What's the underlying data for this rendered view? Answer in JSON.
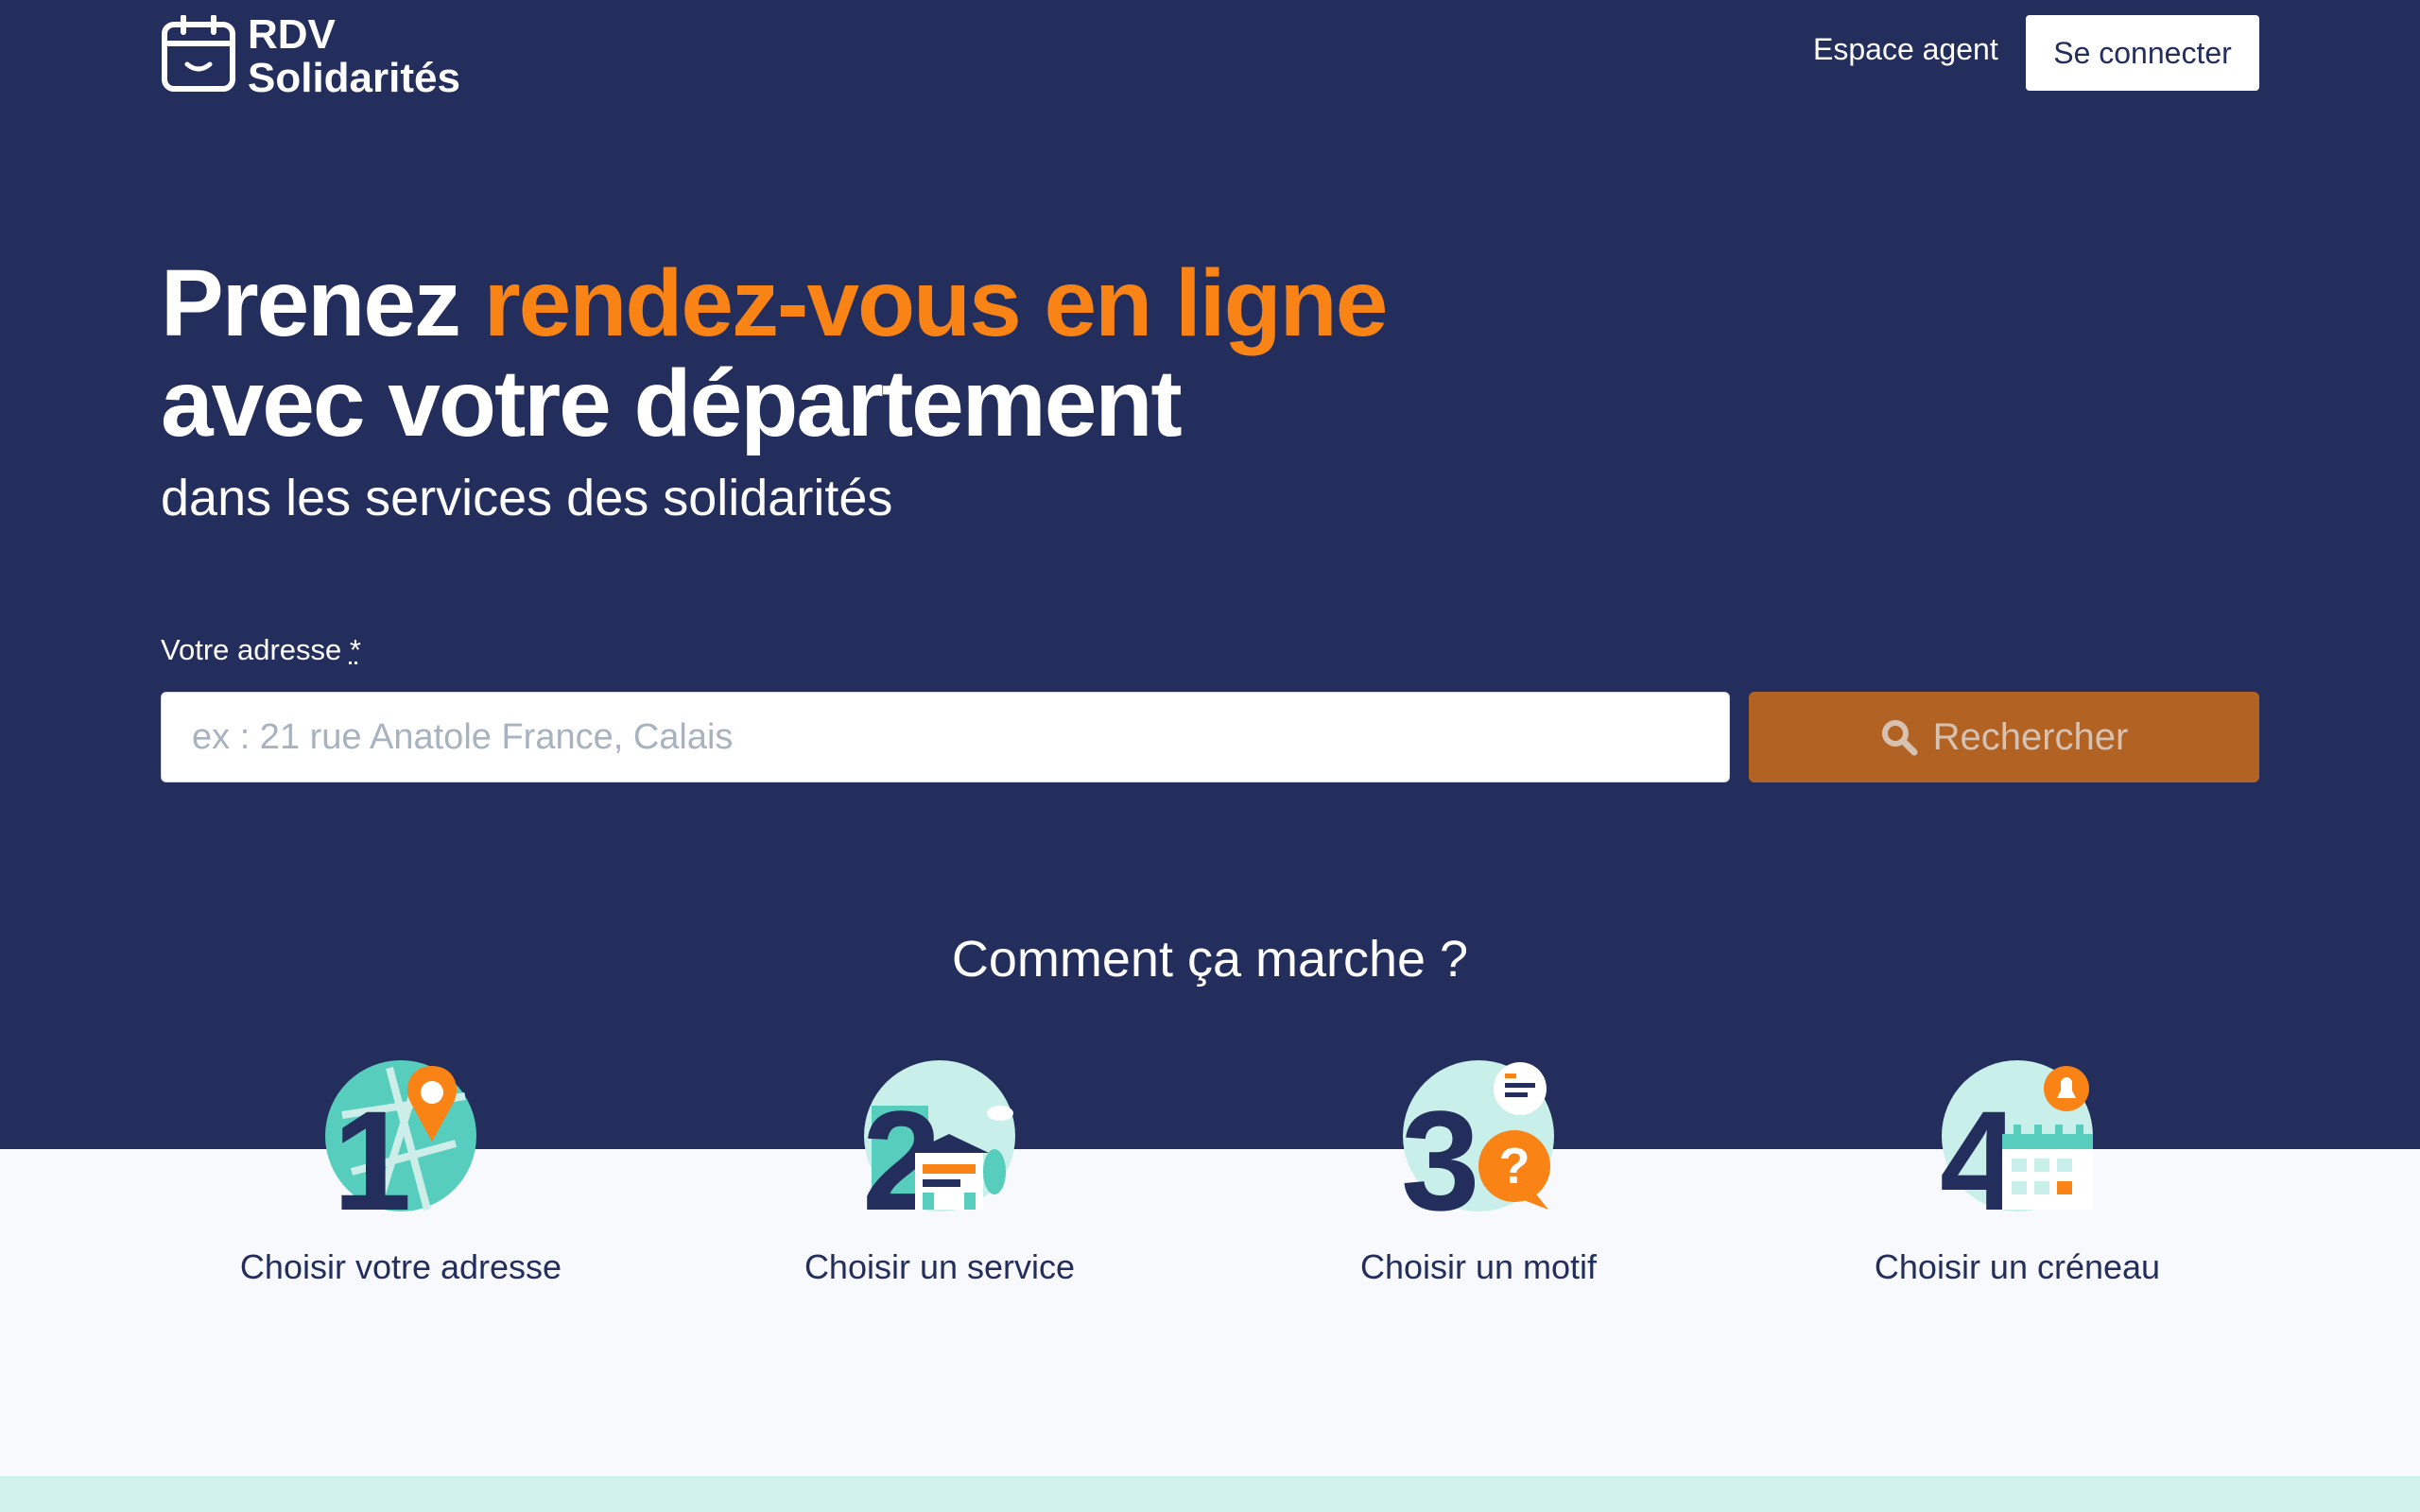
{
  "header": {
    "logo_line1": "RDV",
    "logo_line2": "Solidarités",
    "agent_link": "Espace agent",
    "login_button": "Se connecter"
  },
  "hero": {
    "title_part1": "Prenez ",
    "title_accent": "rendez-vous en ligne",
    "title_line2": "avec votre département",
    "subtitle": "dans les services des solidarités"
  },
  "search": {
    "label": "Votre adresse ",
    "required_mark": "*",
    "placeholder": "ex : 21 rue Anatole France, Calais",
    "value": "",
    "button_label": "Rechercher"
  },
  "how": {
    "title": "Comment ça marche ?",
    "steps": [
      {
        "number": "1",
        "label": "Choisir votre adresse",
        "icon": "map-pin-icon"
      },
      {
        "number": "2",
        "label": "Choisir un service",
        "icon": "building-icon"
      },
      {
        "number": "3",
        "label": "Choisir un motif",
        "icon": "question-chat-icon"
      },
      {
        "number": "4",
        "label": "Choisir un créneau",
        "icon": "calendar-bell-icon"
      }
    ]
  },
  "colors": {
    "navy": "#232e5c",
    "orange": "#f98315",
    "button_brown": "#b26223",
    "mint": "#d0f2ec",
    "teal": "#57cdbd"
  }
}
